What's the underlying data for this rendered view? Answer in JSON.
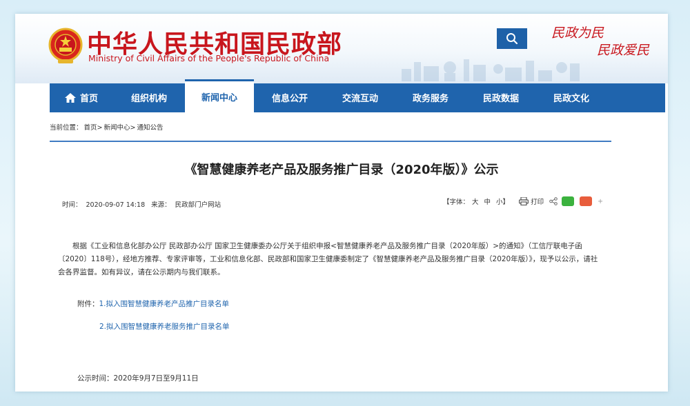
{
  "header": {
    "title_cn": "中华人民共和国民政部",
    "title_en": "Ministry of Civil Affairs of the People's Republic of China",
    "slogan_line1": "民政为民",
    "slogan_line2": "民政爱民",
    "search_icon": "search-icon",
    "emblem_icon": "national-emblem"
  },
  "nav": {
    "items": [
      {
        "label": "首页"
      },
      {
        "label": "组织机构"
      },
      {
        "label": "新闻中心"
      },
      {
        "label": "信息公开"
      },
      {
        "label": "交流互动"
      },
      {
        "label": "政务服务"
      },
      {
        "label": "民政数据"
      },
      {
        "label": "民政文化"
      }
    ],
    "active": "新闻中心"
  },
  "breadcrumb": {
    "prefix": "当前位置：",
    "items": [
      "首页>",
      "新闻中心>",
      "通知公告"
    ]
  },
  "article": {
    "title": "《智慧健康养老产品及服务推广目录（2020年版）》公示",
    "time_label": "时间：",
    "time": "2020-09-07 14:18",
    "source_label": "来源：",
    "source": "民政部门户网站",
    "font_label": "【字体：",
    "font_large": "大",
    "font_medium": "中",
    "font_small": "小】",
    "print_label": "打印",
    "plus": "+",
    "body": "根据《工业和信息化部办公厅 民政部办公厅 国家卫生健康委办公厅关于组织申报<智慧健康养老产品及服务推广目录（2020年版）>的通知》（工信厅联电子函〔2020〕118号），经地方推荐、专家评审等，工业和信息化部、民政部和国家卫生健康委制定了《智慧健康养老产品及服务推广目录（2020年版）》，现予以公示，请社会各界监督。如有异议，请在公示期内与我们联系。",
    "attachments_label": "附件：",
    "attachments": [
      {
        "num": "1.",
        "text": "拟入围智慧健康养老产品推广目录名单"
      },
      {
        "num": "2.",
        "text": "拟入围智慧健康养老服务推广目录名单"
      }
    ],
    "period_label": "公示时间：",
    "period": "2020年9月7日至9月11日"
  },
  "colors": {
    "brand_red": "#c8161d",
    "nav_blue": "#1f64ad",
    "link_blue": "#1f64ad"
  }
}
